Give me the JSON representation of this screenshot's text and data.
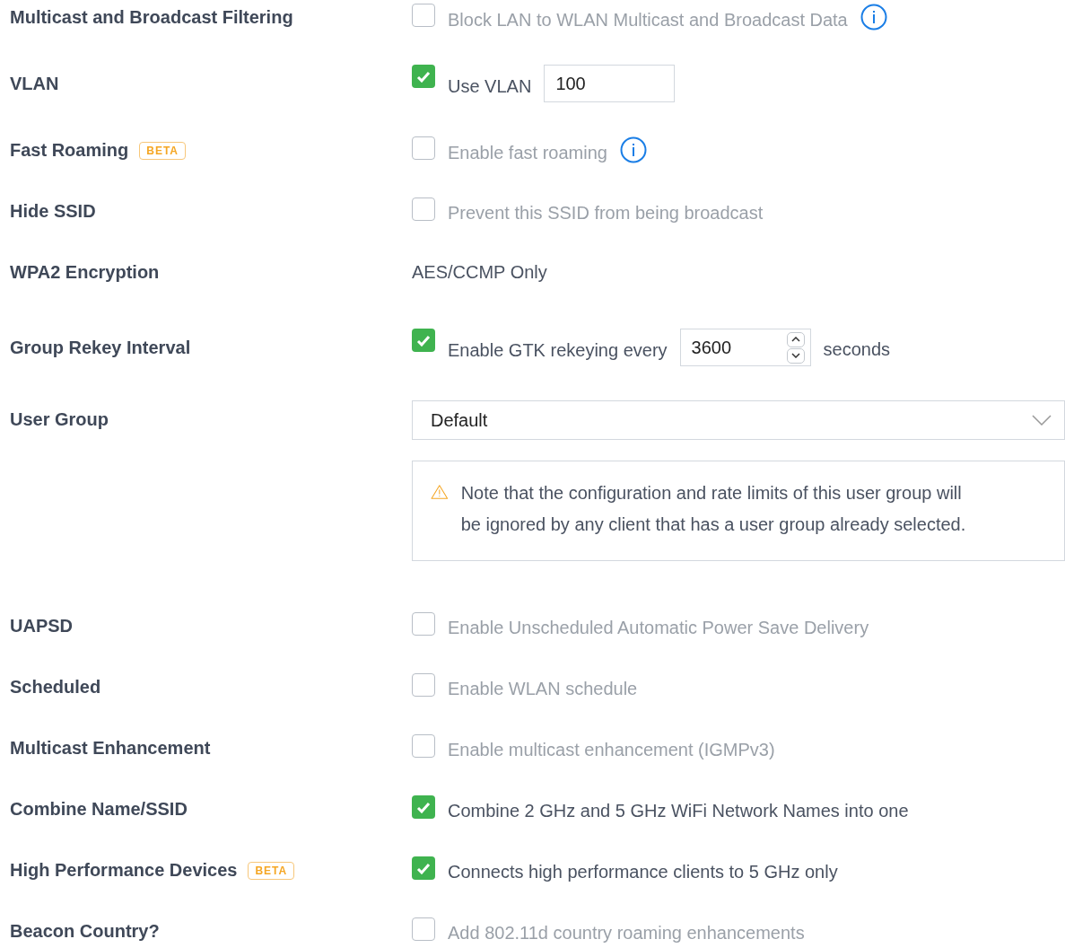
{
  "settings": [
    {
      "kind": "checkbox",
      "label": "Multicast and Broadcast Filtering",
      "checked": false,
      "text": "Block LAN to WLAN Multicast and Broadcast Data",
      "info": true
    },
    {
      "kind": "checkbox",
      "label": "VLAN",
      "checked": true,
      "text": "Use VLAN",
      "input": {
        "value": "100",
        "spinner": false
      }
    },
    {
      "kind": "checkbox",
      "label": "Fast Roaming",
      "badge": "BETA",
      "checked": false,
      "text": "Enable fast roaming",
      "info": true
    },
    {
      "kind": "checkbox",
      "label": "Hide SSID",
      "checked": false,
      "text": "Prevent this SSID from being broadcast"
    },
    {
      "kind": "text",
      "label": "WPA2 Encryption",
      "text": "AES/CCMP Only"
    },
    {
      "kind": "checkbox",
      "label": "Group Rekey Interval",
      "checked": true,
      "text": "Enable GTK rekeying every",
      "input": {
        "value": "3600",
        "spinner": true
      },
      "suffix": "seconds"
    },
    {
      "kind": "select",
      "label": "User Group",
      "value": "Default",
      "note": "Note that the configuration and rate limits of this user group will be ignored by any client that has a user group already selected."
    },
    {
      "kind": "checkbox",
      "label": "UAPSD",
      "checked": false,
      "text": "Enable Unscheduled Automatic Power Save Delivery"
    },
    {
      "kind": "checkbox",
      "label": "Scheduled",
      "checked": false,
      "text": "Enable WLAN schedule"
    },
    {
      "kind": "checkbox",
      "label": "Multicast Enhancement",
      "checked": false,
      "text": "Enable multicast enhancement (IGMPv3)"
    },
    {
      "kind": "checkbox",
      "label": "Combine Name/SSID",
      "checked": true,
      "text": "Combine 2 GHz and 5 GHz WiFi Network Names into one"
    },
    {
      "kind": "checkbox",
      "label": "High Performance Devices",
      "badge": "BETA",
      "checked": true,
      "text": "Connects high performance clients to 5 GHz only"
    },
    {
      "kind": "checkbox",
      "label": "Beacon Country?",
      "checked": false,
      "text": "Add 802.11d country roaming enhancements"
    }
  ]
}
